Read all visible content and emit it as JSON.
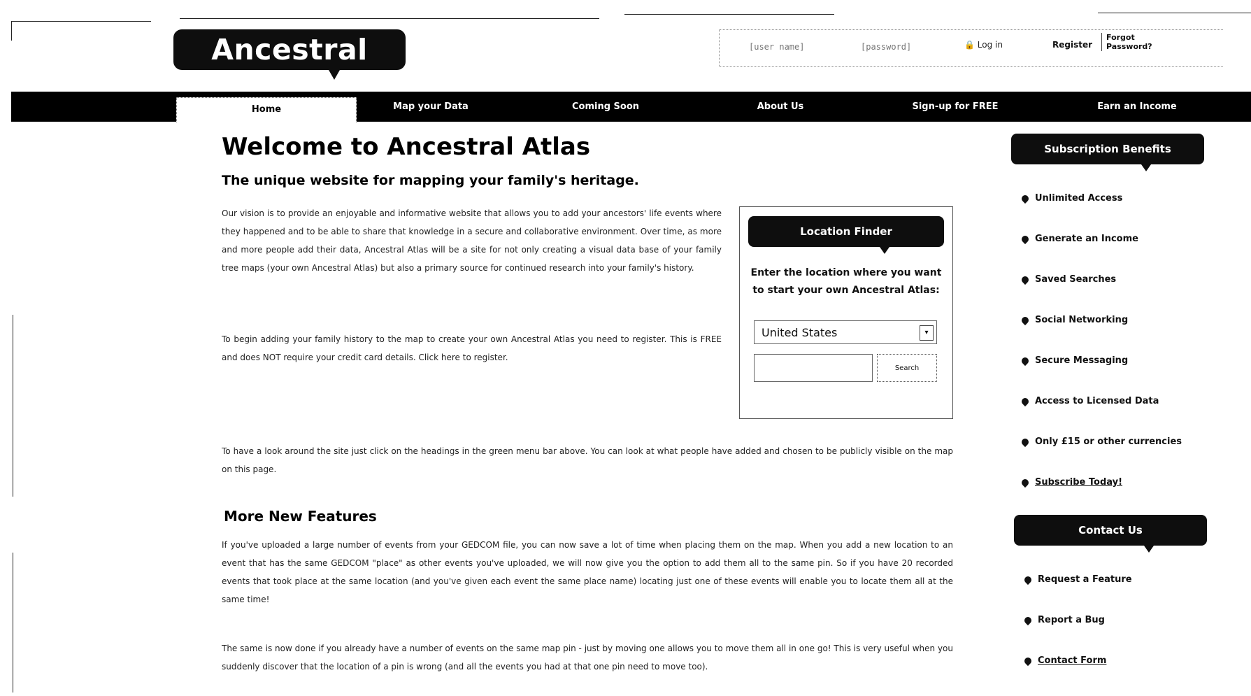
{
  "header": {
    "logo": "Ancestral Atlas",
    "login": {
      "username_placeholder": "[user name]",
      "password_placeholder": "[password]",
      "login_label": "Log in",
      "register_label": "Register",
      "forgot_label": "Forgot Password?"
    }
  },
  "nav": {
    "items": [
      {
        "label": "Home"
      },
      {
        "label": "Map your Data"
      },
      {
        "label": "Coming Soon"
      },
      {
        "label": "About Us"
      },
      {
        "label": "Sign-up for FREE"
      },
      {
        "label": "Earn an Income"
      }
    ]
  },
  "main": {
    "title": "Welcome to Ancestral Atlas",
    "subtitle": "The unique website for mapping your family's heritage.",
    "p1": "Our vision is to provide an enjoyable and informative website that allows you to add your ancestors' life events where they happened and to be able to share that knowledge in a secure and collaborative environment. Over time, as more and more people add their data, Ancestral Atlas will be a site for not only creating a visual data base of your family tree maps (your own Ancestral Atlas) but also a primary source for continued research into your family's history.",
    "p2": "To begin adding your family history to the map to create your own Ancestral Atlas you need to register. This is FREE and does NOT require your credit card details. Click here to register.",
    "p3": "To have a look around the site just click on the headings in the green menu bar above. You can look at what people have added and chosen to be publicly visible on the map on this page.",
    "features_heading": "More New Features",
    "p4": "If you've uploaded a large number of events from your GEDCOM file, you can now save a lot of time when placing them on the map. When you add a new location to an event that has the same GEDCOM \"place\" as other events you've uploaded, we will now give you the option to add them all to the same pin. So if you have 20 recorded events that took place at the same location (and you've given each event the same place name) locating just one of these events will enable you to locate them all at the same time!",
    "p5": "The same is now done if you already have a number of events on the same map pin - just by moving one allows you to move them all in one go! This is very useful when you suddenly discover that the location of a pin is wrong (and all the events you had at that one pin need to move too)."
  },
  "finder": {
    "title": "Location Finder",
    "prompt": "Enter the location where you want to start your own Ancestral Atlas:",
    "country": "United States",
    "go_label": "Search"
  },
  "sidebar": {
    "benefits_title": "Subscription Benefits",
    "benefits": [
      {
        "label": "Unlimited Access"
      },
      {
        "label": "Generate an Income"
      },
      {
        "label": "Saved Searches"
      },
      {
        "label": "Social Networking"
      },
      {
        "label": "Secure Messaging"
      },
      {
        "label": "Access to Licensed Data"
      },
      {
        "label": "Only £15 or other currencies"
      },
      {
        "label": "Subscribe Today!"
      }
    ],
    "contact_title": "Contact Us",
    "contacts": [
      {
        "label": "Request a Feature"
      },
      {
        "label": "Report a Bug"
      },
      {
        "label": "Contact Form"
      }
    ]
  }
}
